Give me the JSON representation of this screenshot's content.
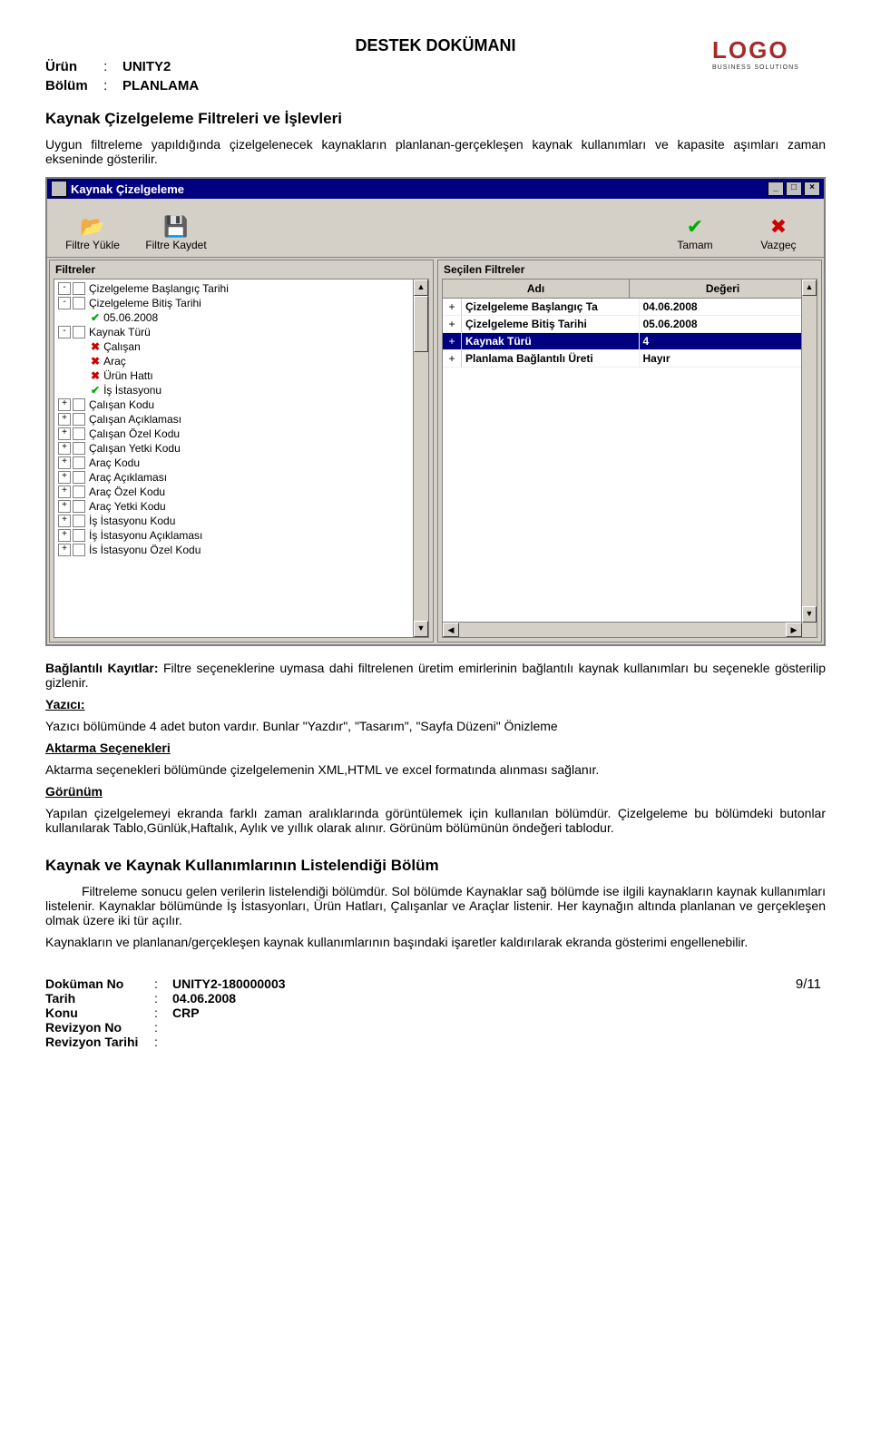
{
  "doc_title": "DESTEK DOKÜMANI",
  "logo": {
    "name": "LOGO",
    "tag": "BUSINESS SOLUTIONS"
  },
  "hdr": {
    "urun_l": "Ürün",
    "urun_v": "UNITY2",
    "bolum_l": "Bölüm",
    "bolum_v": "PLANLAMA"
  },
  "sec1": "Kaynak Çizelgeleme Filtreleri ve İşlevleri",
  "p1": "Uygun filtreleme yapıldığında çizelgelenecek kaynakların planlanan-gerçekleşen kaynak kullanımları ve kapasite aşımları zaman ekseninde gösterilir.",
  "app": {
    "title": "Kaynak Çizelgeleme",
    "tb": {
      "yukle": "Filtre Yükle",
      "kaydet": "Filtre Kaydet",
      "tamam": "Tamam",
      "vazgec": "Vazgeç"
    },
    "left_head": "Filtreler",
    "right_head": "Seçilen Filtreler",
    "grid_h1": "Adı",
    "grid_h2": "Değeri",
    "tree": [
      {
        "pm": "-",
        "lbl": "Çizelgeleme Başlangıç Tarihi"
      },
      {
        "pm": "-",
        "lbl": "Çizelgeleme Bitiş Tarihi"
      },
      {
        "sub": true,
        "mark": "tick",
        "lbl": "05.06.2008"
      },
      {
        "pm": "-",
        "lbl": "Kaynak Türü"
      },
      {
        "sub": true,
        "mark": "x",
        "lbl": "Çalışan"
      },
      {
        "sub": true,
        "mark": "x",
        "lbl": "Araç"
      },
      {
        "sub": true,
        "mark": "x",
        "lbl": "Ürün Hattı"
      },
      {
        "sub": true,
        "mark": "tick",
        "lbl": "İş İstasyonu"
      },
      {
        "pm": "+",
        "lbl": "Çalışan Kodu"
      },
      {
        "pm": "+",
        "lbl": "Çalışan Açıklaması"
      },
      {
        "pm": "+",
        "lbl": "Çalışan Özel Kodu"
      },
      {
        "pm": "+",
        "lbl": "Çalışan Yetki Kodu"
      },
      {
        "pm": "+",
        "lbl": "Araç Kodu"
      },
      {
        "pm": "+",
        "lbl": "Araç Açıklaması"
      },
      {
        "pm": "+",
        "lbl": "Araç Özel Kodu"
      },
      {
        "pm": "+",
        "lbl": "Araç Yetki Kodu"
      },
      {
        "pm": "+",
        "lbl": "İş İstasyonu Kodu"
      },
      {
        "pm": "+",
        "lbl": "İş İstasyonu Açıklaması"
      },
      {
        "pm": "+",
        "lbl": "İs İstasyonu Özel Kodu"
      }
    ],
    "grid": [
      {
        "n": "Çizelgeleme Başlangıç Ta",
        "v": "04.06.2008",
        "sel": false
      },
      {
        "n": "Çizelgeleme Bitiş Tarihi",
        "v": "05.06.2008",
        "sel": false
      },
      {
        "n": "Kaynak Türü",
        "v": "4",
        "sel": true
      },
      {
        "n": "Planlama Bağlantılı Üreti",
        "v": "Hayır",
        "sel": false
      }
    ]
  },
  "bk_l": "Bağlantılı Kayıtlar:",
  "bk_t": "  Filtre seçeneklerine uymasa dahi filtrelenen üretim emirlerinin bağlantılı kaynak kullanımları bu seçenekle gösterilip gizlenir.",
  "yaz_h": "Yazıcı:",
  "yaz_t": "Yazıcı bölümünde 4 adet buton  vardır. Bunlar \"Yazdır\", \"Tasarım\", \"Sayfa Düzeni\" Önizleme",
  "akt_h": "Aktarma Seçenekleri",
  "akt_t": "Aktarma seçenekleri bölümünde çizelgelemenin  XML,HTML ve excel formatında alınması sağlanır.",
  "gor_h": "Görünüm",
  "gor_t": "Yapılan çizelgelemeyi ekranda farklı zaman aralıklarında görüntülemek için kullanılan bölümdür. Çizelgeleme bu bölümdeki butonlar kullanılarak Tablo,Günlük,Haftalık, Aylık ve yıllık olarak alınır. Görünüm bölümünün öndeğeri tablodur.",
  "sec2": "Kaynak ve Kaynak Kullanımlarının Listelendiği Bölüm",
  "p2": "Filtreleme sonucu gelen verilerin listelendiği bölümdür. Sol bölümde Kaynaklar sağ bölümde ise ilgili kaynakların kaynak kullanımları listelenir.  Kaynaklar bölümünde İş İstasyonları, Ürün Hatları, Çalışanlar ve Araçlar listenir. Her kaynağın altında planlanan ve gerçekleşen olmak üzere iki tür açılır.",
  "p3": "Kaynakların ve planlanan/gerçekleşen kaynak kullanımlarının başındaki işaretler kaldırılarak ekranda gösterimi engellenebilir.",
  "footer": {
    "dokno_l": "Doküman No",
    "dokno_v": "UNITY2-180000003",
    "tarih_l": "Tarih",
    "tarih_v": "04.06.2008",
    "konu_l": "Konu",
    "konu_v": "CRP",
    "revno_l": "Revizyon No",
    "revno_v": "",
    "revt_l": "Revizyon Tarihi",
    "revt_v": "",
    "page": "9/11"
  }
}
